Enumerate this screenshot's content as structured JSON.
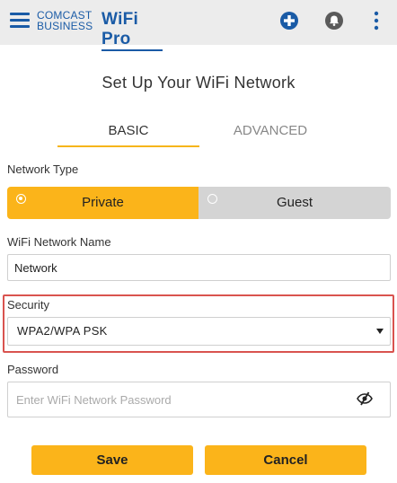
{
  "header": {
    "brand_line1": "COMCAST",
    "brand_line2": "BUSINESS",
    "product": "WiFi Pro",
    "icons": [
      "menu-icon",
      "add-circle-icon",
      "bell-icon",
      "more-vert-icon"
    ],
    "accent_color": "#1a5ba6"
  },
  "page": {
    "title": "Set Up Your WiFi Network"
  },
  "tabs": [
    {
      "label": "BASIC",
      "selected": true
    },
    {
      "label": "ADVANCED",
      "selected": false
    }
  ],
  "form": {
    "network_type_label": "Network Type",
    "network_type_options": [
      {
        "label": "Private",
        "selected": true
      },
      {
        "label": "Guest",
        "selected": false
      }
    ],
    "network_name_label": "WiFi Network Name",
    "network_name_value": "Network",
    "security_label": "Security",
    "security_value": "WPA2/WPA PSK",
    "password_label": "Password",
    "password_placeholder": "Enter WiFi Network Password",
    "password_value": ""
  },
  "actions": {
    "save_label": "Save",
    "cancel_label": "Cancel",
    "button_color": "#fbb41a"
  },
  "highlight_color": "#d9534f"
}
